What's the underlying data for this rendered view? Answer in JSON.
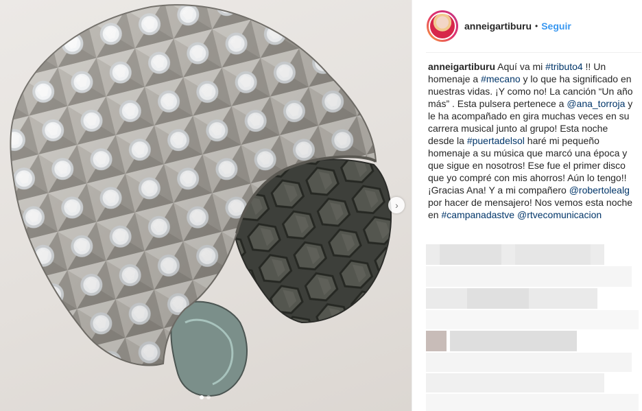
{
  "post": {
    "username": "anneigartiburu",
    "separator": "•",
    "follow_label": "Seguir",
    "caption": [
      {
        "t": "text",
        "v": "Aquí va mi "
      },
      {
        "t": "tag",
        "v": "#tributo4"
      },
      {
        "t": "text",
        "v": " !! Un homenaje a "
      },
      {
        "t": "tag",
        "v": "#mecano"
      },
      {
        "t": "text",
        "v": " y lo que ha significado en nuestras vidas. ¡Y como no! La canción “Un año más” . Esta pulsera pertenece a "
      },
      {
        "t": "mention",
        "v": "@ana_torroja"
      },
      {
        "t": "text",
        "v": " y le ha acompañado en gira muchas veces en su carrera musical junto al grupo! Esta noche desde la "
      },
      {
        "t": "tag",
        "v": "#puertadelsol"
      },
      {
        "t": "text",
        "v": " haré mi pequeño homenaje a su música que marcó una época y que sigue en nosotros! Ese fue el primer disco que yo compré con mis ahorros! Aún lo tengo!! ¡Gracias Ana! Y a mi compañero "
      },
      {
        "t": "mention",
        "v": "@robertolealg"
      },
      {
        "t": "text",
        "v": " por hacer de mensajero! Nos vemos esta noche en "
      },
      {
        "t": "tag",
        "v": "#campanadastve"
      },
      {
        "t": "text",
        "v": " "
      },
      {
        "t": "mention",
        "v": "@rtvecomunicacion"
      }
    ]
  },
  "carousel": {
    "slides": 2,
    "current": 1
  },
  "icons": {
    "next": "chevron-right-icon"
  },
  "colors": {
    "link": "#003569",
    "follow": "#3897f0",
    "text": "#262626"
  }
}
